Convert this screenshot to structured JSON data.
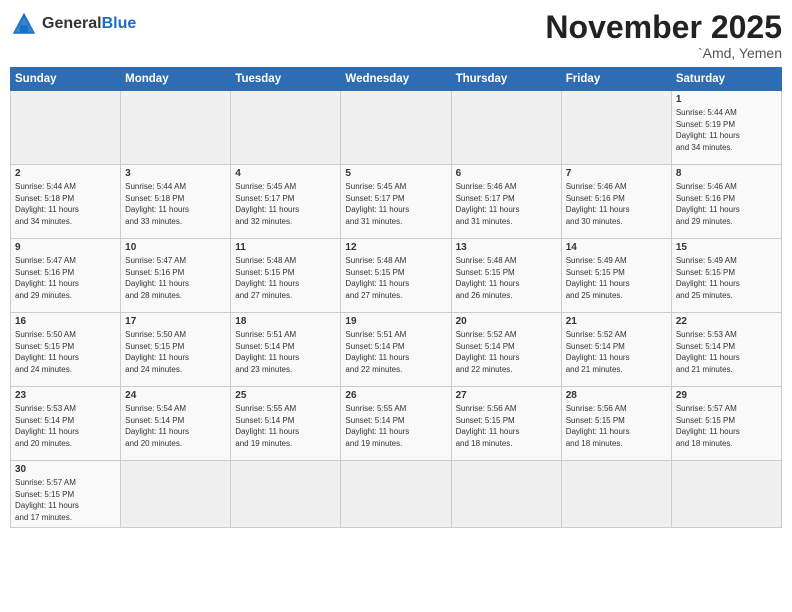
{
  "logo": {
    "text_general": "General",
    "text_blue": "Blue"
  },
  "header": {
    "month": "November 2025",
    "location": "`Amd, Yemen"
  },
  "weekdays": [
    "Sunday",
    "Monday",
    "Tuesday",
    "Wednesday",
    "Thursday",
    "Friday",
    "Saturday"
  ],
  "weeks": [
    [
      {
        "day": "",
        "info": ""
      },
      {
        "day": "",
        "info": ""
      },
      {
        "day": "",
        "info": ""
      },
      {
        "day": "",
        "info": ""
      },
      {
        "day": "",
        "info": ""
      },
      {
        "day": "",
        "info": ""
      },
      {
        "day": "1",
        "info": "Sunrise: 5:44 AM\nSunset: 5:19 PM\nDaylight: 11 hours\nand 34 minutes."
      }
    ],
    [
      {
        "day": "2",
        "info": "Sunrise: 5:44 AM\nSunset: 5:18 PM\nDaylight: 11 hours\nand 34 minutes."
      },
      {
        "day": "3",
        "info": "Sunrise: 5:44 AM\nSunset: 5:18 PM\nDaylight: 11 hours\nand 33 minutes."
      },
      {
        "day": "4",
        "info": "Sunrise: 5:45 AM\nSunset: 5:17 PM\nDaylight: 11 hours\nand 32 minutes."
      },
      {
        "day": "5",
        "info": "Sunrise: 5:45 AM\nSunset: 5:17 PM\nDaylight: 11 hours\nand 31 minutes."
      },
      {
        "day": "6",
        "info": "Sunrise: 5:46 AM\nSunset: 5:17 PM\nDaylight: 11 hours\nand 31 minutes."
      },
      {
        "day": "7",
        "info": "Sunrise: 5:46 AM\nSunset: 5:16 PM\nDaylight: 11 hours\nand 30 minutes."
      },
      {
        "day": "8",
        "info": "Sunrise: 5:46 AM\nSunset: 5:16 PM\nDaylight: 11 hours\nand 29 minutes."
      }
    ],
    [
      {
        "day": "9",
        "info": "Sunrise: 5:47 AM\nSunset: 5:16 PM\nDaylight: 11 hours\nand 29 minutes."
      },
      {
        "day": "10",
        "info": "Sunrise: 5:47 AM\nSunset: 5:16 PM\nDaylight: 11 hours\nand 28 minutes."
      },
      {
        "day": "11",
        "info": "Sunrise: 5:48 AM\nSunset: 5:15 PM\nDaylight: 11 hours\nand 27 minutes."
      },
      {
        "day": "12",
        "info": "Sunrise: 5:48 AM\nSunset: 5:15 PM\nDaylight: 11 hours\nand 27 minutes."
      },
      {
        "day": "13",
        "info": "Sunrise: 5:48 AM\nSunset: 5:15 PM\nDaylight: 11 hours\nand 26 minutes."
      },
      {
        "day": "14",
        "info": "Sunrise: 5:49 AM\nSunset: 5:15 PM\nDaylight: 11 hours\nand 25 minutes."
      },
      {
        "day": "15",
        "info": "Sunrise: 5:49 AM\nSunset: 5:15 PM\nDaylight: 11 hours\nand 25 minutes."
      }
    ],
    [
      {
        "day": "16",
        "info": "Sunrise: 5:50 AM\nSunset: 5:15 PM\nDaylight: 11 hours\nand 24 minutes."
      },
      {
        "day": "17",
        "info": "Sunrise: 5:50 AM\nSunset: 5:15 PM\nDaylight: 11 hours\nand 24 minutes."
      },
      {
        "day": "18",
        "info": "Sunrise: 5:51 AM\nSunset: 5:14 PM\nDaylight: 11 hours\nand 23 minutes."
      },
      {
        "day": "19",
        "info": "Sunrise: 5:51 AM\nSunset: 5:14 PM\nDaylight: 11 hours\nand 22 minutes."
      },
      {
        "day": "20",
        "info": "Sunrise: 5:52 AM\nSunset: 5:14 PM\nDaylight: 11 hours\nand 22 minutes."
      },
      {
        "day": "21",
        "info": "Sunrise: 5:52 AM\nSunset: 5:14 PM\nDaylight: 11 hours\nand 21 minutes."
      },
      {
        "day": "22",
        "info": "Sunrise: 5:53 AM\nSunset: 5:14 PM\nDaylight: 11 hours\nand 21 minutes."
      }
    ],
    [
      {
        "day": "23",
        "info": "Sunrise: 5:53 AM\nSunset: 5:14 PM\nDaylight: 11 hours\nand 20 minutes."
      },
      {
        "day": "24",
        "info": "Sunrise: 5:54 AM\nSunset: 5:14 PM\nDaylight: 11 hours\nand 20 minutes."
      },
      {
        "day": "25",
        "info": "Sunrise: 5:55 AM\nSunset: 5:14 PM\nDaylight: 11 hours\nand 19 minutes."
      },
      {
        "day": "26",
        "info": "Sunrise: 5:55 AM\nSunset: 5:14 PM\nDaylight: 11 hours\nand 19 minutes."
      },
      {
        "day": "27",
        "info": "Sunrise: 5:56 AM\nSunset: 5:15 PM\nDaylight: 11 hours\nand 18 minutes."
      },
      {
        "day": "28",
        "info": "Sunrise: 5:56 AM\nSunset: 5:15 PM\nDaylight: 11 hours\nand 18 minutes."
      },
      {
        "day": "29",
        "info": "Sunrise: 5:57 AM\nSunset: 5:15 PM\nDaylight: 11 hours\nand 18 minutes."
      }
    ],
    [
      {
        "day": "30",
        "info": "Sunrise: 5:57 AM\nSunset: 5:15 PM\nDaylight: 11 hours\nand 17 minutes."
      },
      {
        "day": "",
        "info": ""
      },
      {
        "day": "",
        "info": ""
      },
      {
        "day": "",
        "info": ""
      },
      {
        "day": "",
        "info": ""
      },
      {
        "day": "",
        "info": ""
      },
      {
        "day": "",
        "info": ""
      }
    ]
  ]
}
